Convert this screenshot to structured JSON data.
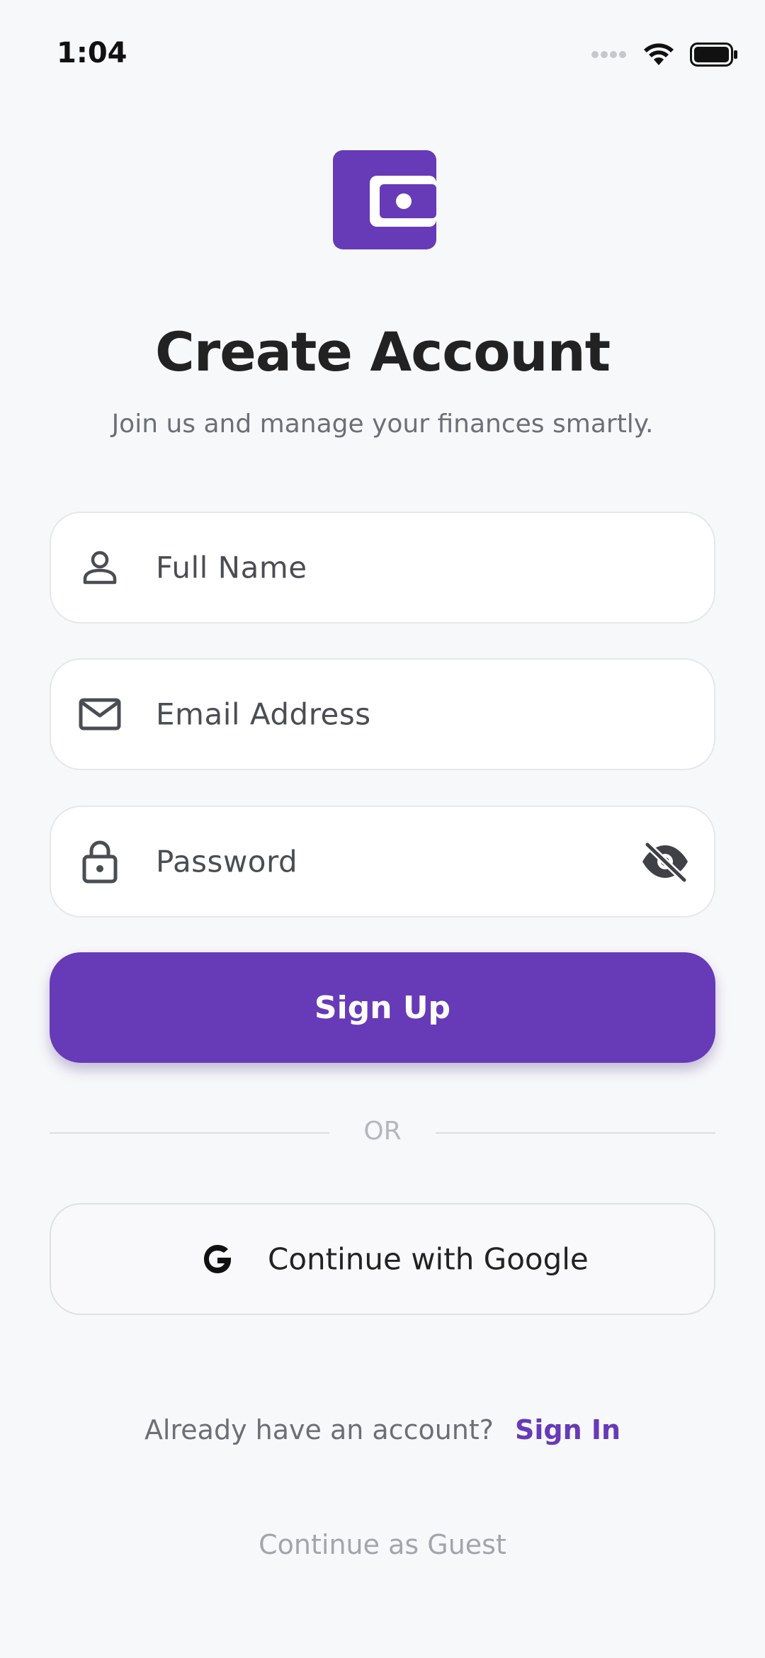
{
  "status_bar": {
    "time": "1:04"
  },
  "header": {
    "title": "Create Account",
    "subtitle": "Join us and manage your finances smartly."
  },
  "form": {
    "full_name_placeholder": "Full Name",
    "email_placeholder": "Email Address",
    "password_placeholder": "Password"
  },
  "actions": {
    "sign_up_label": "Sign Up",
    "or_label": "OR",
    "google_label": "Continue with Google",
    "already_label": "Already have an account?",
    "sign_in_label": "Sign In",
    "guest_label": "Continue as Guest"
  },
  "icons": {
    "logo": "wallet-icon",
    "full_name": "person-icon",
    "email": "mail-icon",
    "password": "lock-icon",
    "toggle": "eye-off-icon",
    "google": "google-g-icon"
  },
  "colors": {
    "accent": "#673ab7",
    "background": "#f7f8fa"
  }
}
